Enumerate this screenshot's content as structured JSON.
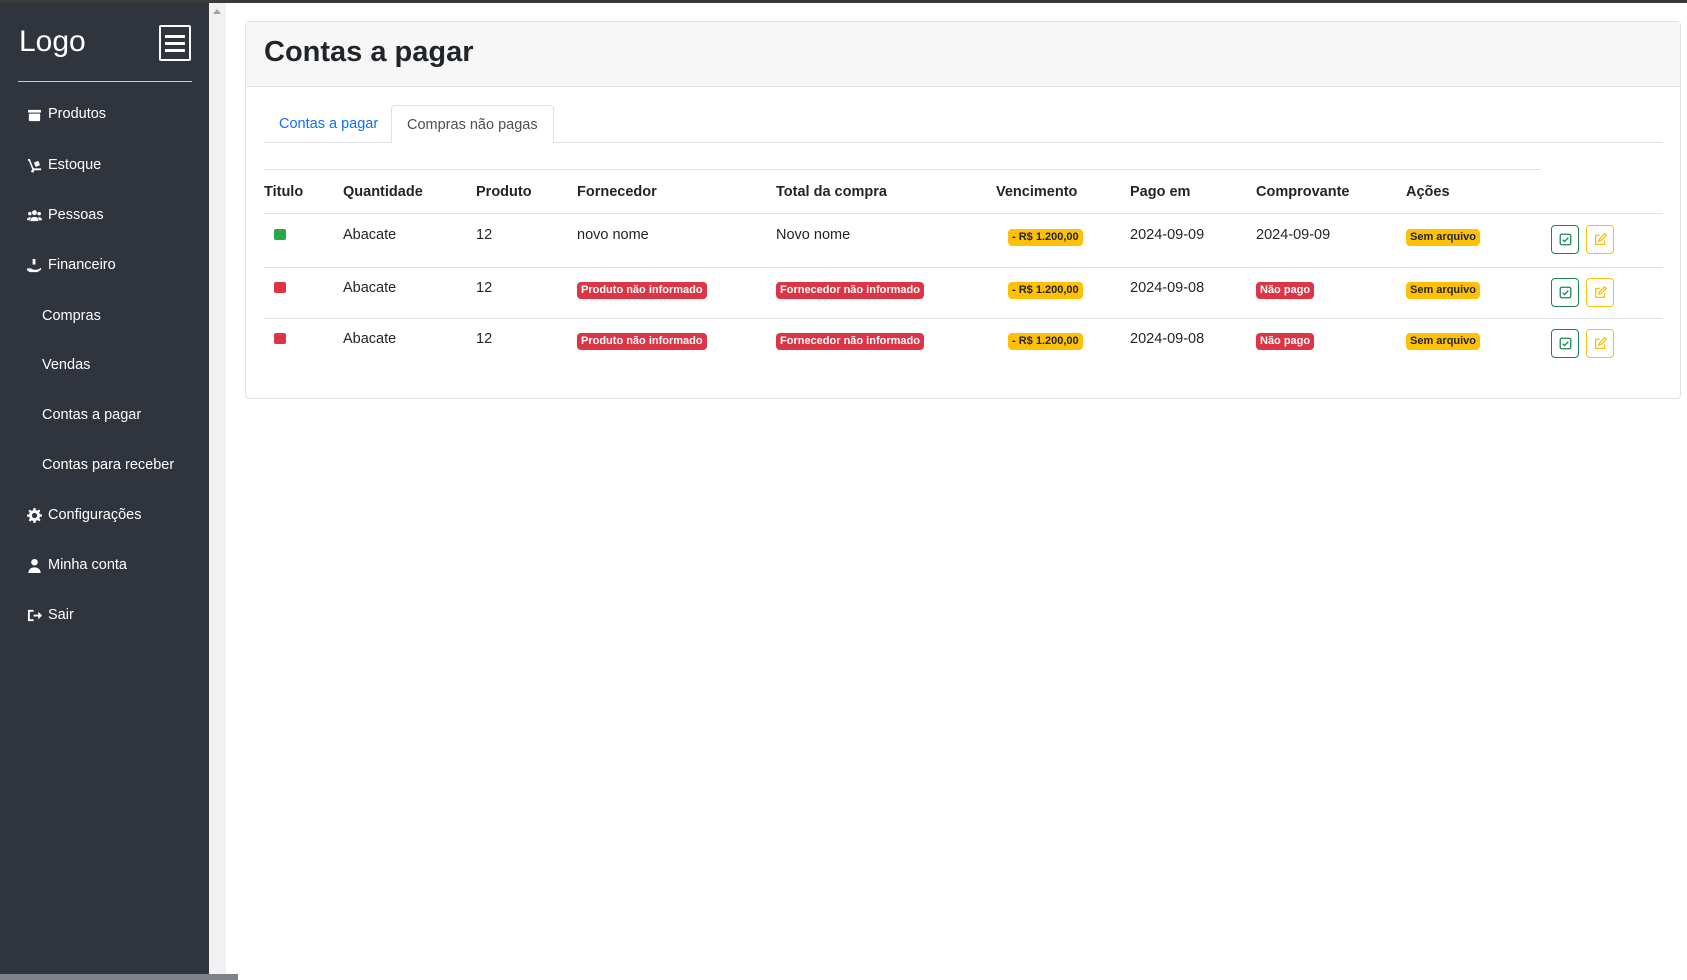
{
  "sidebar": {
    "logo": "Logo",
    "items": [
      {
        "label": "Produtos",
        "icon": "box-icon"
      },
      {
        "label": "Estoque",
        "icon": "dolly-icon"
      },
      {
        "label": "Pessoas",
        "icon": "users-icon"
      },
      {
        "label": "Financeiro",
        "icon": "hand-money-icon"
      },
      {
        "label": "Compras"
      },
      {
        "label": "Vendas"
      },
      {
        "label": "Contas a pagar"
      },
      {
        "label": "Contas para receber"
      },
      {
        "label": "Configurações",
        "icon": "gear-icon"
      },
      {
        "label": "Minha conta",
        "icon": "user-icon"
      },
      {
        "label": "Sair",
        "icon": "sign-out-icon"
      }
    ]
  },
  "page": {
    "title": "Contas a pagar"
  },
  "tabs": [
    {
      "label": "Contas a pagar",
      "active": false
    },
    {
      "label": "Compras não pagas",
      "active": true
    }
  ],
  "table": {
    "headers": [
      "Titulo",
      "Quantidade",
      "Produto",
      "Fornecedor",
      "Total da compra",
      "Vencimento",
      "Pago em",
      "Comprovante",
      "Ações"
    ],
    "rows": [
      {
        "status_color": "#28a745",
        "quantidade": "Abacate",
        "produto": "12",
        "fornecedor": "novo nome",
        "total": "Novo nome",
        "vencimento": "- R$ 1.200,00",
        "pago_em": "2024-09-09",
        "comprovante": "2024-09-09",
        "acoes": "Sem arquivo"
      },
      {
        "status_color": "#dc3545",
        "quantidade": "Abacate",
        "produto": "12",
        "fornecedor": "Produto não informado",
        "total": "Fornecedor não informado",
        "vencimento": "- R$ 1.200,00",
        "pago_em": "2024-09-08",
        "comprovante": "Não pago",
        "acoes": "Sem arquivo"
      },
      {
        "status_color": "#dc3545",
        "quantidade": "Abacate",
        "produto": "12",
        "fornecedor": "Produto não informado",
        "total": "Fornecedor não informado",
        "vencimento": "- R$ 1.200,00",
        "pago_em": "2024-09-08",
        "comprovante": "Não pago",
        "acoes": "Sem arquivo"
      }
    ]
  },
  "colors": {
    "sidebar_bg": "#30343d",
    "link": "#0d6efd",
    "danger": "#dc3545",
    "warning": "#ffc107",
    "success": "#198754"
  }
}
